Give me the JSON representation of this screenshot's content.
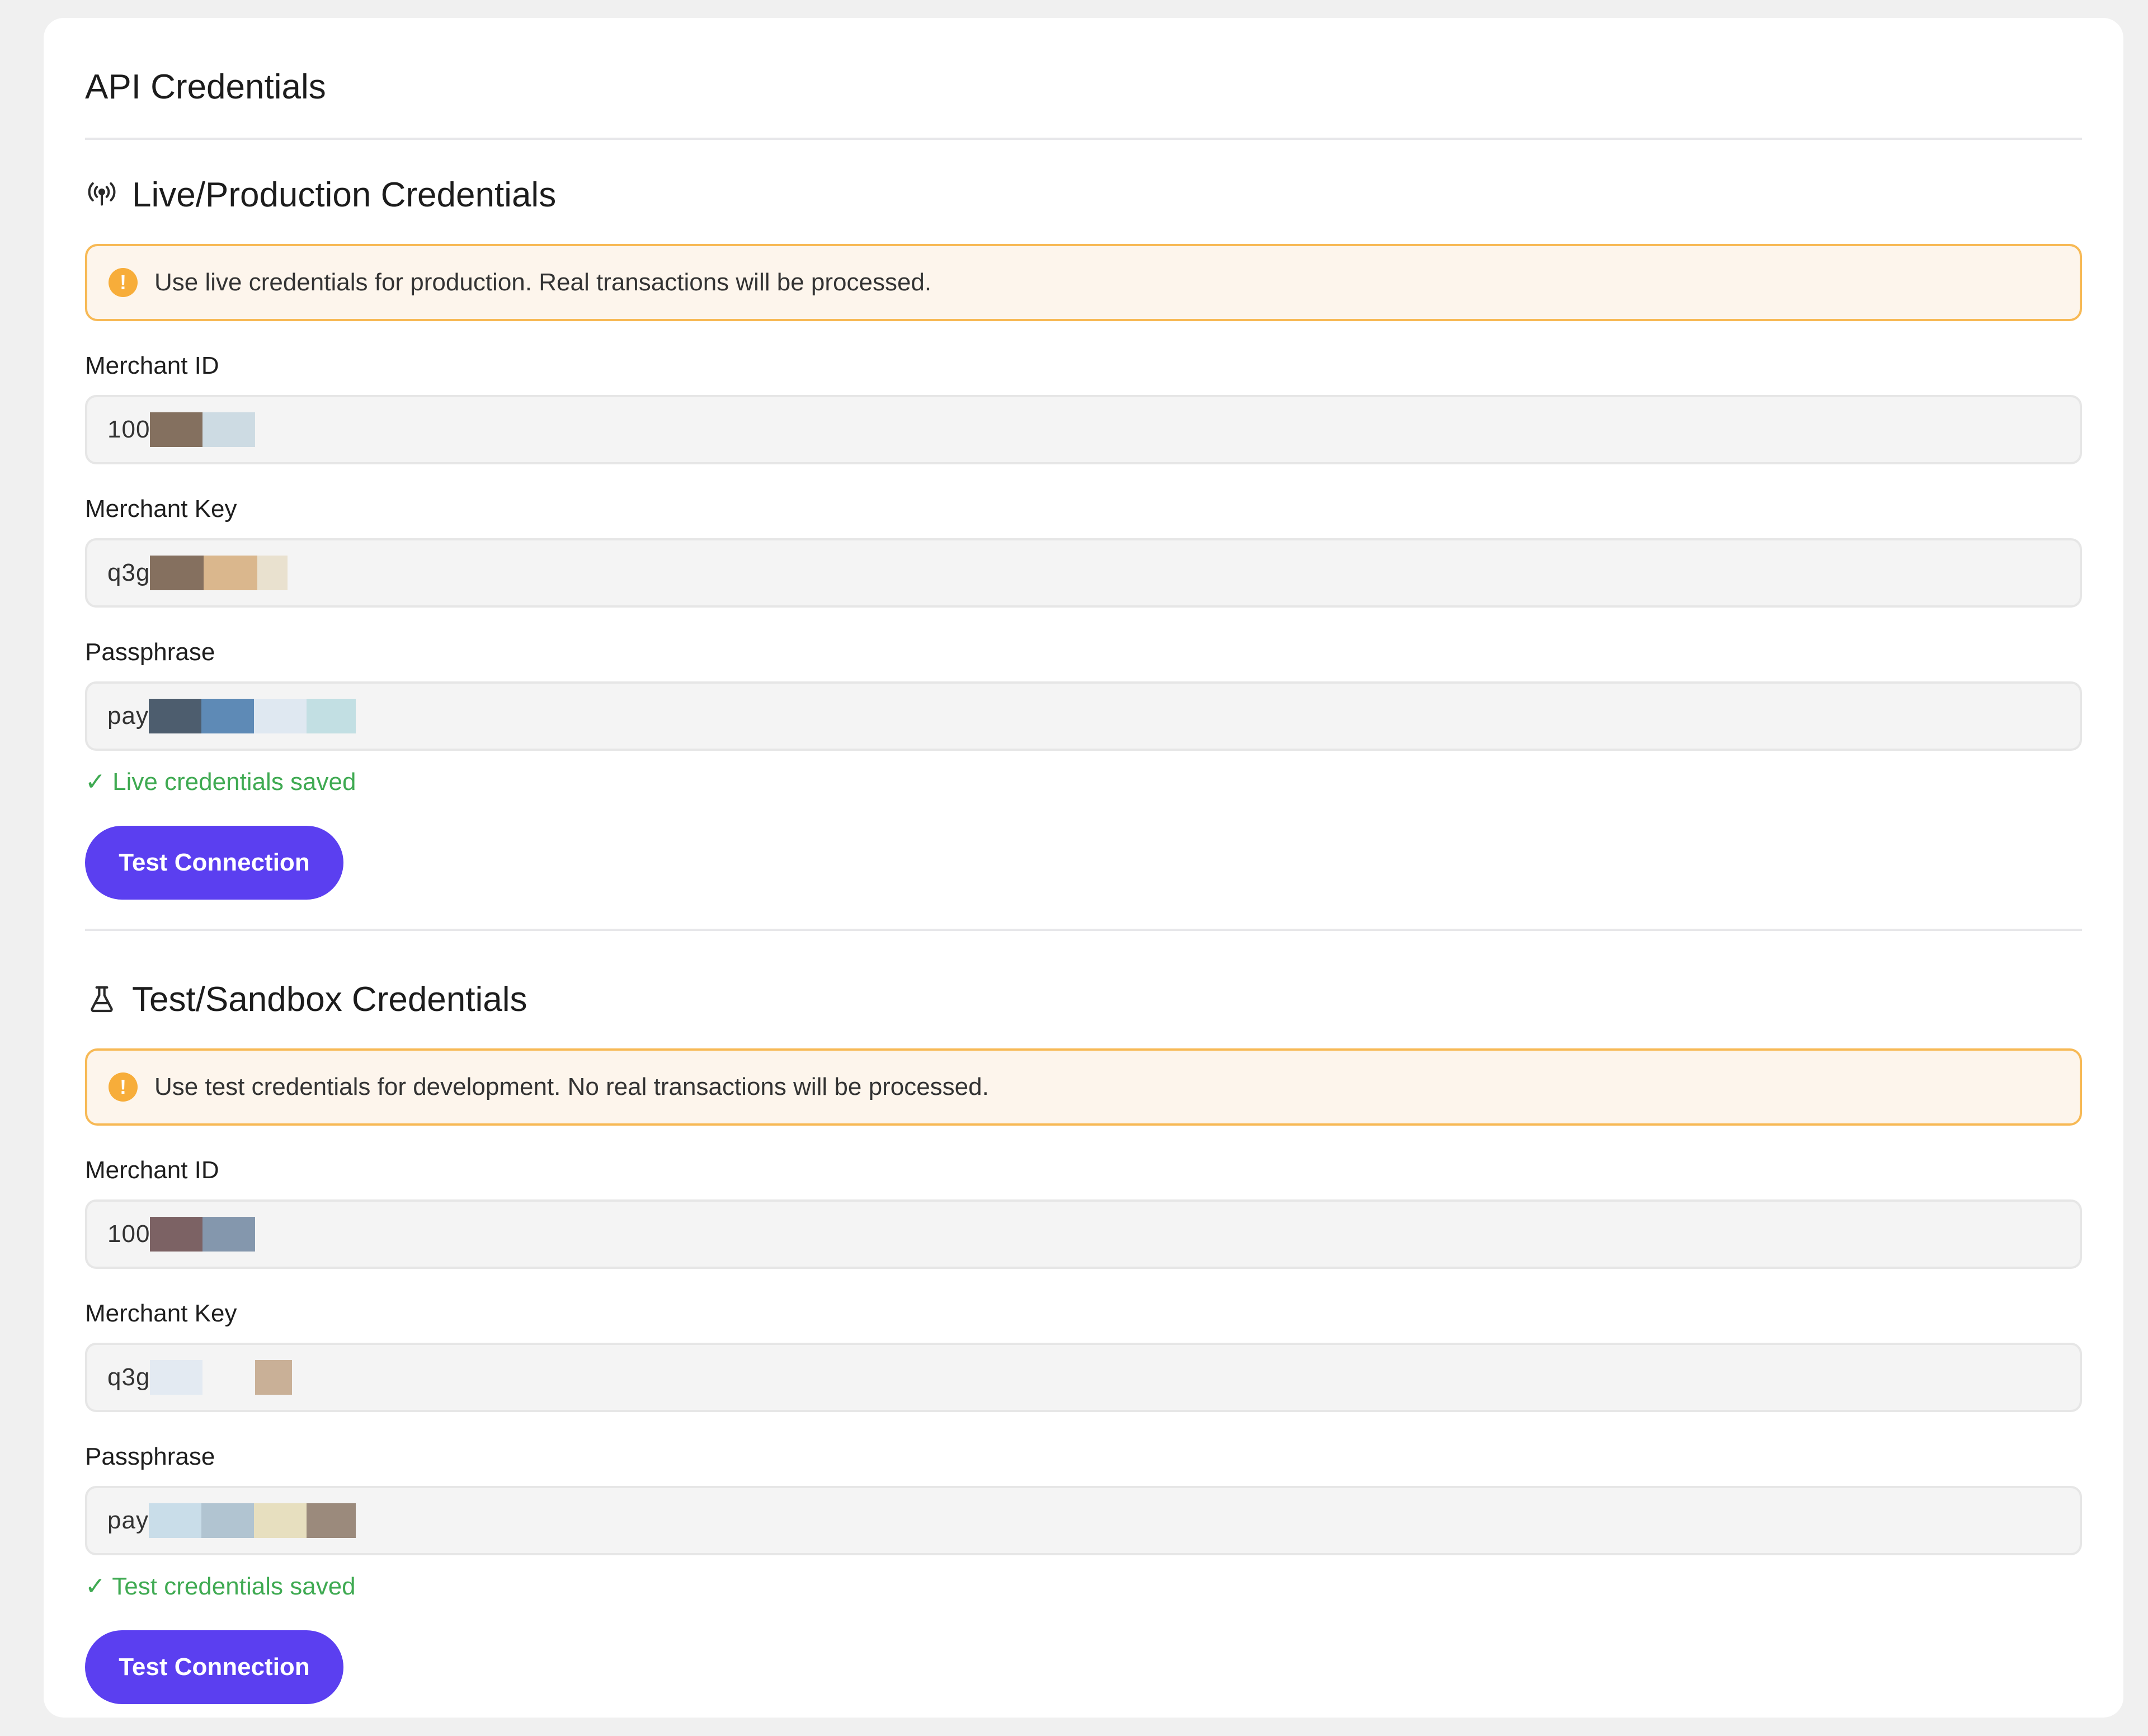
{
  "card": {
    "title": "API Credentials"
  },
  "live": {
    "icon": "broadcast-icon",
    "title": "Live/Production Credentials",
    "alert_icon": "warning-icon",
    "alert_text": "Use live credentials for production. Real transactions will be processed.",
    "merchant_id_label": "Merchant ID",
    "merchant_id_visible": "100",
    "merchant_key_label": "Merchant Key",
    "merchant_key_visible": "q3g",
    "passphrase_label": "Passphrase",
    "passphrase_visible": "pay",
    "saved_text": "✓ Live credentials saved",
    "button_label": "Test Connection"
  },
  "test": {
    "icon": "flask-icon",
    "title": "Test/Sandbox Credentials",
    "alert_icon": "warning-icon",
    "alert_text": "Use test credentials for development. No real transactions will be processed.",
    "merchant_id_label": "Merchant ID",
    "merchant_id_visible": "100",
    "merchant_key_label": "Merchant Key",
    "merchant_key_visible": "q3g",
    "passphrase_label": "Passphrase",
    "passphrase_visible": "pay",
    "saved_text": "✓ Test credentials saved",
    "button_label": "Test Connection"
  },
  "colors": {
    "accent": "#5b3ff0",
    "warning_border": "#f7b955",
    "warning_bg": "#fdf5ec",
    "success": "#3faa52"
  },
  "redactions": {
    "live_merchant_id": [
      "#84705f",
      "#cddbe3"
    ],
    "live_merchant_key": [
      "#85705f",
      "#dab78d",
      "#e9e1cf"
    ],
    "live_passphrase": [
      "#4d5d6e",
      "#5e8ab6",
      "#dfe8f1",
      "#c2dfe3"
    ],
    "test_merchant_id": [
      "#7c6264",
      "#8497ad"
    ],
    "test_merchant_key": [
      "#e3eaf2",
      "#ffffff",
      "#c9b097"
    ],
    "test_passphrase": [
      "#c9dde9",
      "#b1c4d1",
      "#e7dfbf",
      "#9b8a7c"
    ]
  }
}
